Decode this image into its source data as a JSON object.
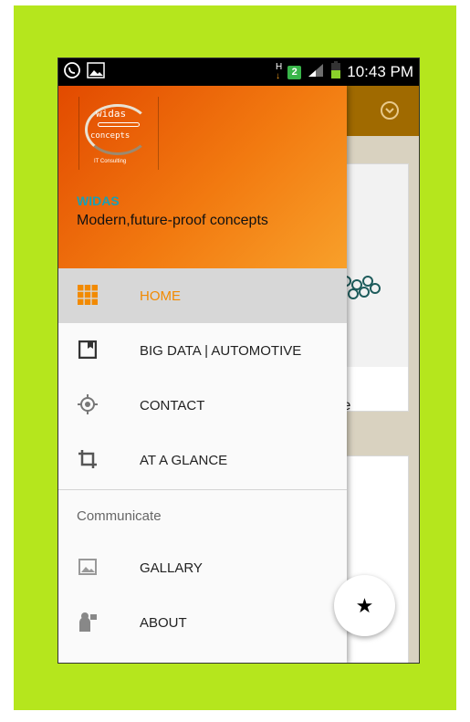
{
  "status_bar": {
    "left_icons": [
      "whatsapp-icon",
      "image-notification-icon"
    ],
    "right_icons": [
      "data-transfer-icon",
      "sim-2-icon",
      "signal-icon",
      "battery-icon"
    ],
    "sim_badge": "2",
    "time": "10:43 PM"
  },
  "drawer": {
    "logo": {
      "top": "widas",
      "bottom": "concepts",
      "sub": "IT Consulting"
    },
    "brand": "WIDAS",
    "tagline": "Modern,future-proof concepts",
    "items": [
      {
        "label": "HOME",
        "icon": "grid-icon",
        "active": true
      },
      {
        "label": "BIG DATA | AUTOMOTIVE",
        "icon": "book-icon"
      },
      {
        "label": "CONTACT",
        "icon": "target-icon"
      },
      {
        "label": "AT A GLANCE",
        "icon": "crop-icon"
      }
    ],
    "section_title": "Communicate",
    "section_items": [
      {
        "label": "GALLARY",
        "icon": "picture-icon"
      },
      {
        "label": "ABOUT",
        "icon": "person-icon"
      }
    ]
  },
  "background": {
    "card_text": "vince"
  },
  "fab": {
    "glyph": "★",
    "icon": "star-icon"
  },
  "colors": {
    "frame": "#b5e61d",
    "accent": "#f28a00",
    "brand": "#19a0b5",
    "header_from": "#e24a00",
    "header_to": "#f8a02a"
  }
}
